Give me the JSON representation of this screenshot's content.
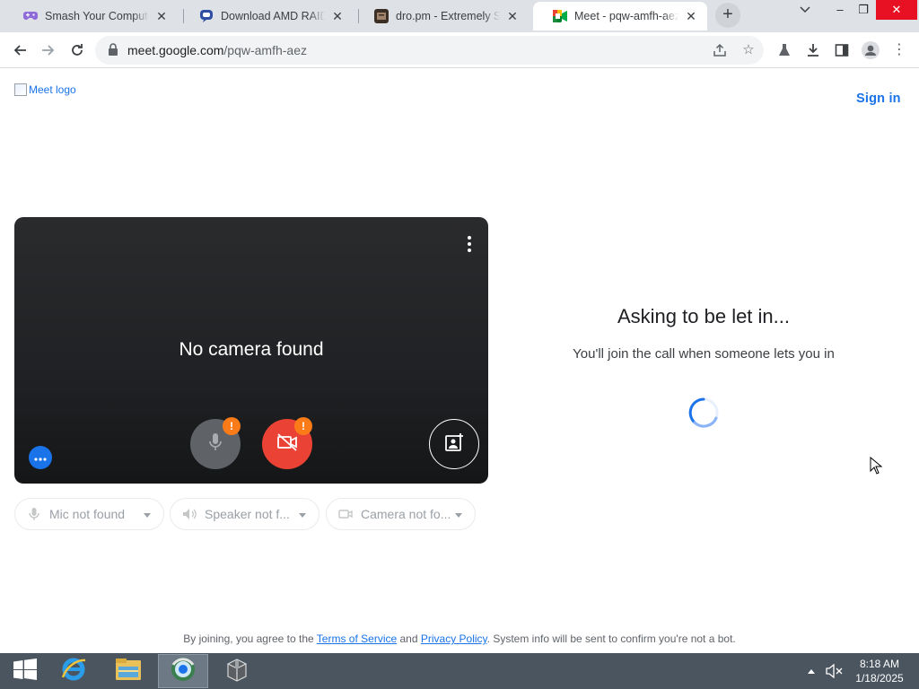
{
  "browser": {
    "tabs": [
      {
        "title": "Smash Your Computer |",
        "icon": "controller-icon",
        "active": false
      },
      {
        "title": "Download AMD RAID D",
        "icon": "chat-bubble-icon",
        "active": false
      },
      {
        "title": "dro.pm - Extremely Sho",
        "icon": "dropm-icon",
        "active": false
      },
      {
        "title": "Meet - pqw-amfh-aez",
        "icon": "google-meet-icon",
        "active": true
      }
    ],
    "new_tab_label": "+",
    "url_domain": "meet.google.com",
    "url_path": "/pqw-amfh-aez"
  },
  "page": {
    "logo_alt": "Meet logo",
    "sign_in": "Sign in",
    "preview": {
      "message": "No camera found",
      "warning_badge": "!"
    },
    "devices": {
      "mic": "Mic not found",
      "speaker": "Speaker not f...",
      "camera": "Camera not fo..."
    },
    "status": {
      "title": "Asking to be let in...",
      "subtitle": "You'll join the call when someone lets you in"
    },
    "footer": {
      "prefix": "By joining, you agree to the ",
      "terms": "Terms of Service",
      "and": " and ",
      "privacy": "Privacy Policy",
      "suffix": ". System info will be sent to confirm you're not a bot."
    }
  },
  "taskbar": {
    "apps": [
      "internet-explorer-icon",
      "file-explorer-icon",
      "browser-globe-icon",
      "archive-box-icon"
    ],
    "time": "8:18 AM",
    "date": "1/18/2025"
  },
  "colors": {
    "accent": "#1a73e8",
    "camera_off_red": "#ea4335",
    "warning_orange": "#fa7b17",
    "tabstrip": "#dee1e6",
    "taskbar": "#4a5560"
  }
}
